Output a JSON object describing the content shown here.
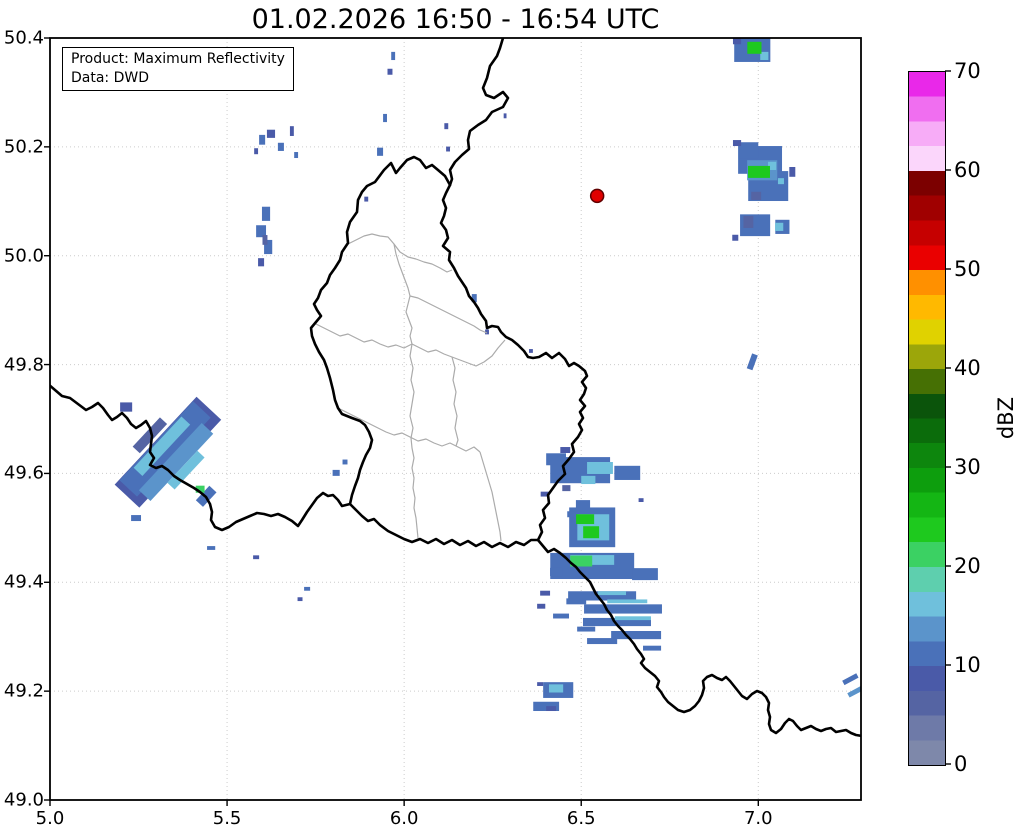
{
  "title": "01.02.2026 16:50 - 16:54 UTC",
  "info_box": {
    "line1": "Product: Maximum Reflectivity",
    "line2": "Data: DWD"
  },
  "axes": {
    "x": {
      "min": 5.0,
      "max": 7.29,
      "tick_values": [
        5.0,
        5.5,
        6.0,
        6.5,
        7.0
      ],
      "tick_labels": [
        "5.0",
        "5.5",
        "6.0",
        "6.5",
        "7.0"
      ]
    },
    "y": {
      "min": 49.0,
      "max": 50.4,
      "tick_values": [
        49.0,
        49.2,
        49.4,
        49.6,
        49.8,
        50.0,
        50.2,
        50.4
      ],
      "tick_labels": [
        "49.0",
        "49.2",
        "49.4",
        "49.6",
        "49.8",
        "50.0",
        "50.2",
        "50.4"
      ]
    }
  },
  "colorbar": {
    "label": "dBZ",
    "min": 0,
    "max": 70,
    "tick_values": [
      0,
      10,
      20,
      30,
      40,
      50,
      60,
      70
    ],
    "tick_labels": [
      "0",
      "10",
      "20",
      "30",
      "40",
      "50",
      "60",
      "70"
    ],
    "segment_step_dbz": 2.5,
    "colors": [
      "#7e88aa",
      "#6e7aa8",
      "#5564a3",
      "#4a5aa8",
      "#4a71b9",
      "#5b94cb",
      "#6fc0dc",
      "#5ecfae",
      "#3bd163",
      "#1ec91e",
      "#14b614",
      "#0d9e0d",
      "#0d860d",
      "#0b6c0b",
      "#0b540b",
      "#467004",
      "#9ca60a",
      "#e0d200",
      "#ffb900",
      "#ff9000",
      "#ea0000",
      "#c60000",
      "#a00000",
      "#7c0000",
      "#fbd6fb",
      "#f7acf7",
      "#f06ef0",
      "#e928e9"
    ]
  },
  "marker": {
    "lon": 6.545,
    "lat": 50.11,
    "fill": "#e00000",
    "edge": "#600000"
  },
  "map": {
    "grid_color": "#cccccc",
    "country_border_color": "#000000",
    "admin_border_color": "#ababab"
  },
  "radar_cells": {
    "format": [
      "lon",
      "lat",
      "width_deg",
      "height_deg",
      "color_index",
      "rotation_deg"
    ],
    "cells": [
      [
        5.215,
        49.722,
        0.034,
        0.017,
        3,
        0
      ],
      [
        5.333,
        49.639,
        0.339,
        0.062,
        3,
        -47
      ],
      [
        5.325,
        49.645,
        0.305,
        0.044,
        4,
        -47
      ],
      [
        5.282,
        49.67,
        0.113,
        0.018,
        2,
        -47
      ],
      [
        5.356,
        49.621,
        0.26,
        0.029,
        5,
        -47
      ],
      [
        5.316,
        49.65,
        0.198,
        0.022,
        6,
        -47
      ],
      [
        5.384,
        49.606,
        0.124,
        0.018,
        6,
        -47
      ],
      [
        5.441,
        49.558,
        0.056,
        0.018,
        4,
        -47
      ],
      [
        5.424,
        49.571,
        0.025,
        0.013,
        8,
        0
      ],
      [
        5.243,
        49.518,
        0.028,
        0.011,
        4,
        0
      ],
      [
        5.455,
        49.463,
        0.023,
        0.007,
        4,
        0
      ],
      [
        5.582,
        49.446,
        0.017,
        0.007,
        3,
        0
      ],
      [
        5.808,
        49.601,
        0.02,
        0.011,
        4,
        0
      ],
      [
        5.833,
        49.621,
        0.014,
        0.009,
        4,
        0
      ],
      [
        5.726,
        49.388,
        0.017,
        0.007,
        4,
        0
      ],
      [
        5.706,
        49.369,
        0.014,
        0.007,
        3,
        0
      ],
      [
        5.599,
        50.213,
        0.017,
        0.018,
        4,
        0
      ],
      [
        5.624,
        50.224,
        0.023,
        0.015,
        3,
        0
      ],
      [
        5.652,
        50.2,
        0.017,
        0.015,
        4,
        0
      ],
      [
        5.683,
        50.229,
        0.011,
        0.018,
        3,
        0
      ],
      [
        5.695,
        50.185,
        0.011,
        0.011,
        4,
        0
      ],
      [
        5.582,
        50.192,
        0.011,
        0.011,
        3,
        0
      ],
      [
        5.61,
        50.077,
        0.023,
        0.026,
        4,
        0
      ],
      [
        5.596,
        50.045,
        0.028,
        0.022,
        4,
        0
      ],
      [
        5.616,
        50.016,
        0.023,
        0.026,
        4,
        0
      ],
      [
        5.596,
        49.988,
        0.017,
        0.015,
        3,
        0
      ],
      [
        5.607,
        50.029,
        0.014,
        0.018,
        2,
        0
      ],
      [
        5.946,
        50.253,
        0.011,
        0.015,
        4,
        0
      ],
      [
        5.932,
        50.191,
        0.017,
        0.015,
        4,
        0
      ],
      [
        5.893,
        50.104,
        0.011,
        0.009,
        3,
        0
      ],
      [
        5.969,
        50.367,
        0.011,
        0.015,
        4,
        0
      ],
      [
        5.96,
        50.338,
        0.014,
        0.011,
        3,
        0
      ],
      [
        6.119,
        50.238,
        0.011,
        0.011,
        3,
        0
      ],
      [
        6.124,
        50.196,
        0.011,
        0.009,
        3,
        0
      ],
      [
        6.285,
        50.257,
        0.008,
        0.009,
        3,
        0
      ],
      [
        6.198,
        49.922,
        0.014,
        0.015,
        4,
        0
      ],
      [
        6.234,
        49.86,
        0.011,
        0.009,
        3,
        0
      ],
      [
        6.358,
        49.825,
        0.011,
        0.007,
        3,
        0
      ],
      [
        6.983,
        50.378,
        0.102,
        0.044,
        4,
        0
      ],
      [
        6.94,
        50.394,
        0.023,
        0.011,
        3,
        0
      ],
      [
        7.017,
        50.367,
        0.023,
        0.015,
        6,
        0
      ],
      [
        6.989,
        50.382,
        0.04,
        0.022,
        9,
        0
      ],
      [
        7.005,
        50.176,
        0.124,
        0.051,
        4,
        0
      ],
      [
        7.028,
        50.128,
        0.113,
        0.055,
        4,
        0
      ],
      [
        6.972,
        50.194,
        0.056,
        0.029,
        4,
        0
      ],
      [
        6.94,
        50.207,
        0.023,
        0.011,
        3,
        0
      ],
      [
        7.096,
        50.154,
        0.017,
        0.018,
        3,
        0
      ],
      [
        6.994,
        50.11,
        0.028,
        0.015,
        2,
        0
      ],
      [
        7.011,
        50.157,
        0.085,
        0.037,
        5,
        0
      ],
      [
        7.039,
        50.165,
        0.023,
        0.015,
        6,
        0
      ],
      [
        7.064,
        50.137,
        0.017,
        0.011,
        6,
        0
      ],
      [
        7.002,
        50.154,
        0.062,
        0.022,
        9,
        0
      ],
      [
        6.991,
        50.056,
        0.085,
        0.04,
        4,
        0
      ],
      [
        7.068,
        50.053,
        0.04,
        0.026,
        4,
        0
      ],
      [
        6.972,
        50.062,
        0.028,
        0.022,
        2,
        0
      ],
      [
        7.059,
        50.053,
        0.023,
        0.015,
        6,
        0
      ],
      [
        6.935,
        50.033,
        0.017,
        0.011,
        3,
        0
      ],
      [
        6.983,
        49.805,
        0.017,
        0.029,
        4,
        20
      ],
      [
        7.26,
        49.222,
        0.045,
        0.009,
        4,
        -28
      ],
      [
        7.277,
        49.2,
        0.051,
        0.009,
        5,
        -28
      ],
      [
        6.497,
        49.606,
        0.169,
        0.048,
        4,
        0
      ],
      [
        6.429,
        49.626,
        0.056,
        0.022,
        4,
        0
      ],
      [
        6.63,
        49.601,
        0.073,
        0.026,
        4,
        0
      ],
      [
        6.455,
        49.643,
        0.028,
        0.011,
        3,
        0
      ],
      [
        6.553,
        49.61,
        0.073,
        0.022,
        6,
        0
      ],
      [
        6.52,
        49.588,
        0.04,
        0.015,
        6,
        0
      ],
      [
        6.458,
        49.573,
        0.023,
        0.011,
        2,
        0
      ],
      [
        6.398,
        49.562,
        0.025,
        0.009,
        3,
        0
      ],
      [
        6.669,
        49.551,
        0.014,
        0.007,
        3,
        0
      ],
      [
        6.531,
        49.501,
        0.13,
        0.073,
        4,
        0
      ],
      [
        6.505,
        49.542,
        0.04,
        0.018,
        4,
        0
      ],
      [
        6.472,
        49.525,
        0.023,
        0.011,
        4,
        0
      ],
      [
        6.534,
        49.501,
        0.09,
        0.048,
        6,
        0
      ],
      [
        6.511,
        49.516,
        0.051,
        0.018,
        9,
        0
      ],
      [
        6.528,
        49.492,
        0.045,
        0.022,
        9,
        0
      ],
      [
        6.531,
        49.43,
        0.237,
        0.048,
        4,
        0
      ],
      [
        6.68,
        49.415,
        0.073,
        0.022,
        4,
        0
      ],
      [
        6.429,
        49.419,
        0.034,
        0.015,
        4,
        0
      ],
      [
        6.531,
        49.441,
        0.124,
        0.018,
        6,
        0
      ],
      [
        6.5,
        49.439,
        0.062,
        0.02,
        8,
        0
      ],
      [
        6.559,
        49.375,
        0.192,
        0.017,
        4,
        0
      ],
      [
        6.618,
        49.351,
        0.22,
        0.017,
        4,
        0
      ],
      [
        6.601,
        49.327,
        0.192,
        0.015,
        4,
        0
      ],
      [
        6.655,
        49.303,
        0.141,
        0.015,
        4,
        0
      ],
      [
        6.559,
        49.292,
        0.085,
        0.011,
        4,
        0
      ],
      [
        6.486,
        49.365,
        0.056,
        0.011,
        4,
        0
      ],
      [
        6.443,
        49.338,
        0.045,
        0.009,
        4,
        0
      ],
      [
        6.587,
        49.38,
        0.079,
        0.007,
        6,
        0
      ],
      [
        6.63,
        49.365,
        0.113,
        0.007,
        6,
        0
      ],
      [
        6.646,
        49.334,
        0.102,
        0.007,
        6,
        0
      ],
      [
        6.514,
        49.314,
        0.051,
        0.009,
        4,
        0
      ],
      [
        6.7,
        49.279,
        0.051,
        0.009,
        4,
        0
      ],
      [
        6.398,
        49.38,
        0.028,
        0.009,
        3,
        0
      ],
      [
        6.387,
        49.356,
        0.023,
        0.009,
        3,
        0
      ],
      [
        6.435,
        49.202,
        0.085,
        0.029,
        4,
        0
      ],
      [
        6.429,
        49.205,
        0.04,
        0.015,
        6,
        0
      ],
      [
        6.384,
        49.213,
        0.017,
        0.007,
        3,
        0
      ],
      [
        6.401,
        49.172,
        0.073,
        0.017,
        4,
        0
      ],
      [
        6.415,
        49.168,
        0.028,
        0.009,
        3,
        0
      ]
    ]
  }
}
